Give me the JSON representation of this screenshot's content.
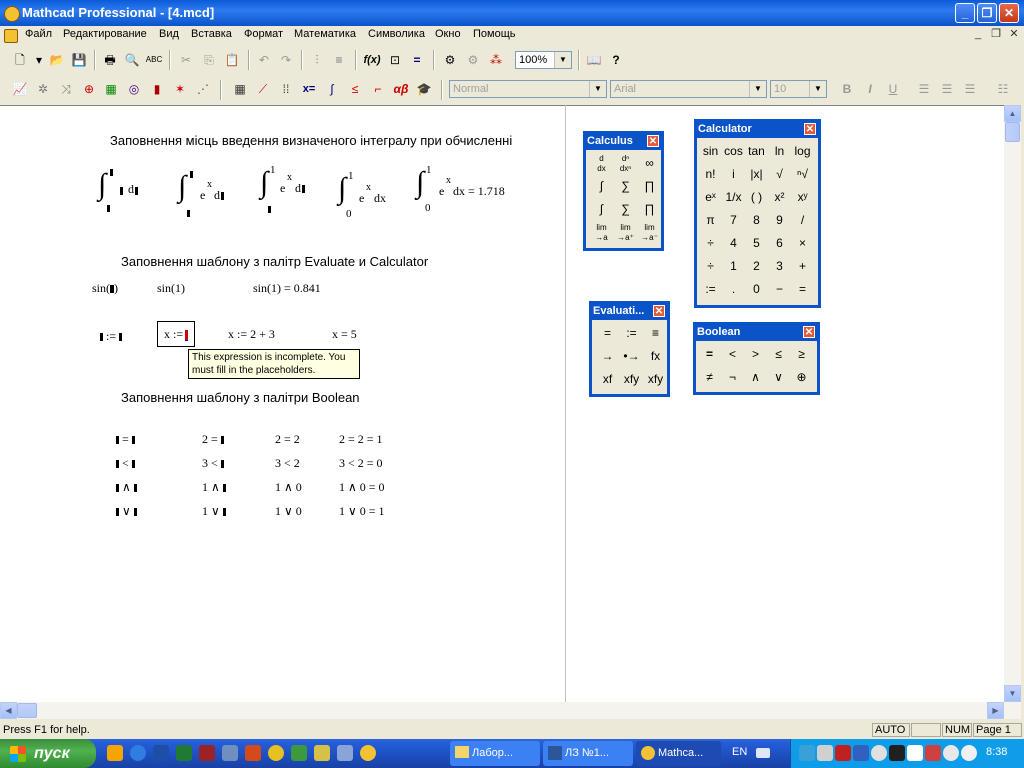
{
  "window": {
    "title": "Mathcad Professional - [4.mcd]"
  },
  "menu": [
    "Файл",
    "Редактирование",
    "Вид",
    "Вставка",
    "Формат",
    "Математика",
    "Символика",
    "Окно",
    "Помощь"
  ],
  "toolbar": {
    "zoom": "100%"
  },
  "format_bar": {
    "style": "Normal",
    "font": "Arial",
    "size": "10"
  },
  "sections": {
    "integrals_heading": "Заповнення місць введення визначеного інтегралу при обчисленні",
    "evaluate_heading": "Заповнення шаблону з палітр Evaluate и Calculator",
    "boolean_heading": "Заповнення шаблону з палітри Boolean"
  },
  "integrals": {
    "lim_upper": "1",
    "lim_lower": "0",
    "e": "e",
    "x": "x",
    "d": "d",
    "dx": "dx",
    "result": "dx = 1.718"
  },
  "evaluate": {
    "sin_ph": "sin(",
    "sin_ph_close": ")",
    "sin1": "sin(1)",
    "sin1_result": "sin(1) = 0.841",
    "assign_ph": ":=",
    "x_assign": "x :=",
    "x_expr": "x := 2 + 3",
    "x_result": "x = 5",
    "tooltip": "This expression is incomplete. You must fill in the placeholders."
  },
  "boolean_rows": [
    {
      "op": "=",
      "c2": "2 =",
      "c3": "2 = 2",
      "c4": "2 = 2 = 1"
    },
    {
      "op": "<",
      "c2": "3 <",
      "c3": "3 < 2",
      "c4": "3 < 2 = 0"
    },
    {
      "op": "∧",
      "c2": "1 ∧",
      "c3": "1 ∧ 0",
      "c4": "1 ∧ 0 = 0"
    },
    {
      "op": "∨",
      "c2": "1 ∨",
      "c3": "1 ∨ 0",
      "c4": "1 ∨ 0 = 1"
    }
  ],
  "palettes": {
    "calculus": {
      "title": "Calculus"
    },
    "calculator": {
      "title": "Calculator",
      "rows": [
        [
          "sin",
          "cos",
          "tan",
          "ln",
          "log"
        ],
        [
          "n!",
          "i",
          "|x|",
          "√",
          "ⁿ√"
        ],
        [
          "eˣ",
          "1/x",
          "( )",
          "x²",
          "xʸ"
        ],
        [
          "π",
          "7",
          "8",
          "9",
          "/"
        ],
        [
          "÷",
          "4",
          "5",
          "6",
          "×"
        ],
        [
          "÷",
          "1",
          "2",
          "3",
          "+"
        ],
        [
          ":=",
          ".",
          "0",
          "−",
          "="
        ]
      ]
    },
    "evaluation": {
      "title": "Evaluati...",
      "cells": [
        "=",
        ":=",
        "≡",
        "→",
        "•→",
        "fx",
        "xf",
        "xfy",
        "xfy"
      ]
    },
    "boolean": {
      "title": "Boolean",
      "cells": [
        "=",
        "<",
        ">",
        "≤",
        "≥",
        "≠",
        "¬",
        "∧",
        "∨",
        "⊕"
      ]
    }
  },
  "status": {
    "help": "Press F1 for help.",
    "auto": "AUTO",
    "num": "NUM",
    "page": "Page 1"
  },
  "taskbar": {
    "start": "пуск",
    "tasks": [
      "Лабор...",
      "ЛЗ №1...",
      "Mathca..."
    ],
    "lang": "EN",
    "clock": "8:38"
  }
}
